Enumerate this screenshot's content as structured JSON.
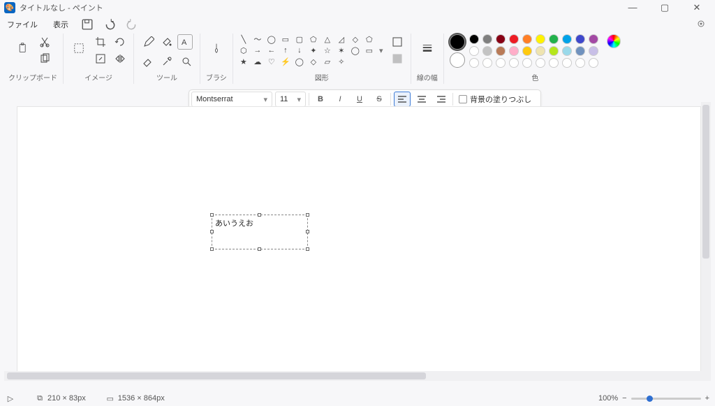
{
  "titlebar": {
    "title": "タイトルなし - ペイント"
  },
  "menubar": {
    "file": "ファイル",
    "view": "表示"
  },
  "ribbon": {
    "clipboard_label": "クリップボード",
    "image_label": "イメージ",
    "tools_label": "ツール",
    "brushes_label": "ブラシ",
    "shapes_label": "図形",
    "linewidth_label": "線の幅",
    "colors_label": "色"
  },
  "text_toolbar": {
    "font": "Montserrat",
    "size": "11",
    "fill_label": "背景の塗りつぶし"
  },
  "canvas": {
    "text_content": "あいうえお"
  },
  "statusbar": {
    "selection": "210 × 83px",
    "canvas_size": "1536 × 864px",
    "zoom": "100%"
  },
  "colors": {
    "current_primary": "#000000",
    "current_secondary": "#ffffff",
    "row1": [
      "#000000",
      "#7f7f7f",
      "#880015",
      "#ed1c24",
      "#ff7f27",
      "#fff200",
      "#22b14c",
      "#00a2e8",
      "#3f48cc",
      "#a349a4"
    ],
    "row2": [
      "#ffffff",
      "#c3c3c3",
      "#b97a57",
      "#ffaec9",
      "#ffc90e",
      "#efe4b0",
      "#b5e61d",
      "#99d9ea",
      "#7092be",
      "#c8bfe7"
    ],
    "row3": [
      "#ffffff",
      "#ffffff",
      "#ffffff",
      "#ffffff",
      "#ffffff",
      "#ffffff",
      "#ffffff",
      "#ffffff",
      "#ffffff",
      "#ffffff"
    ]
  }
}
